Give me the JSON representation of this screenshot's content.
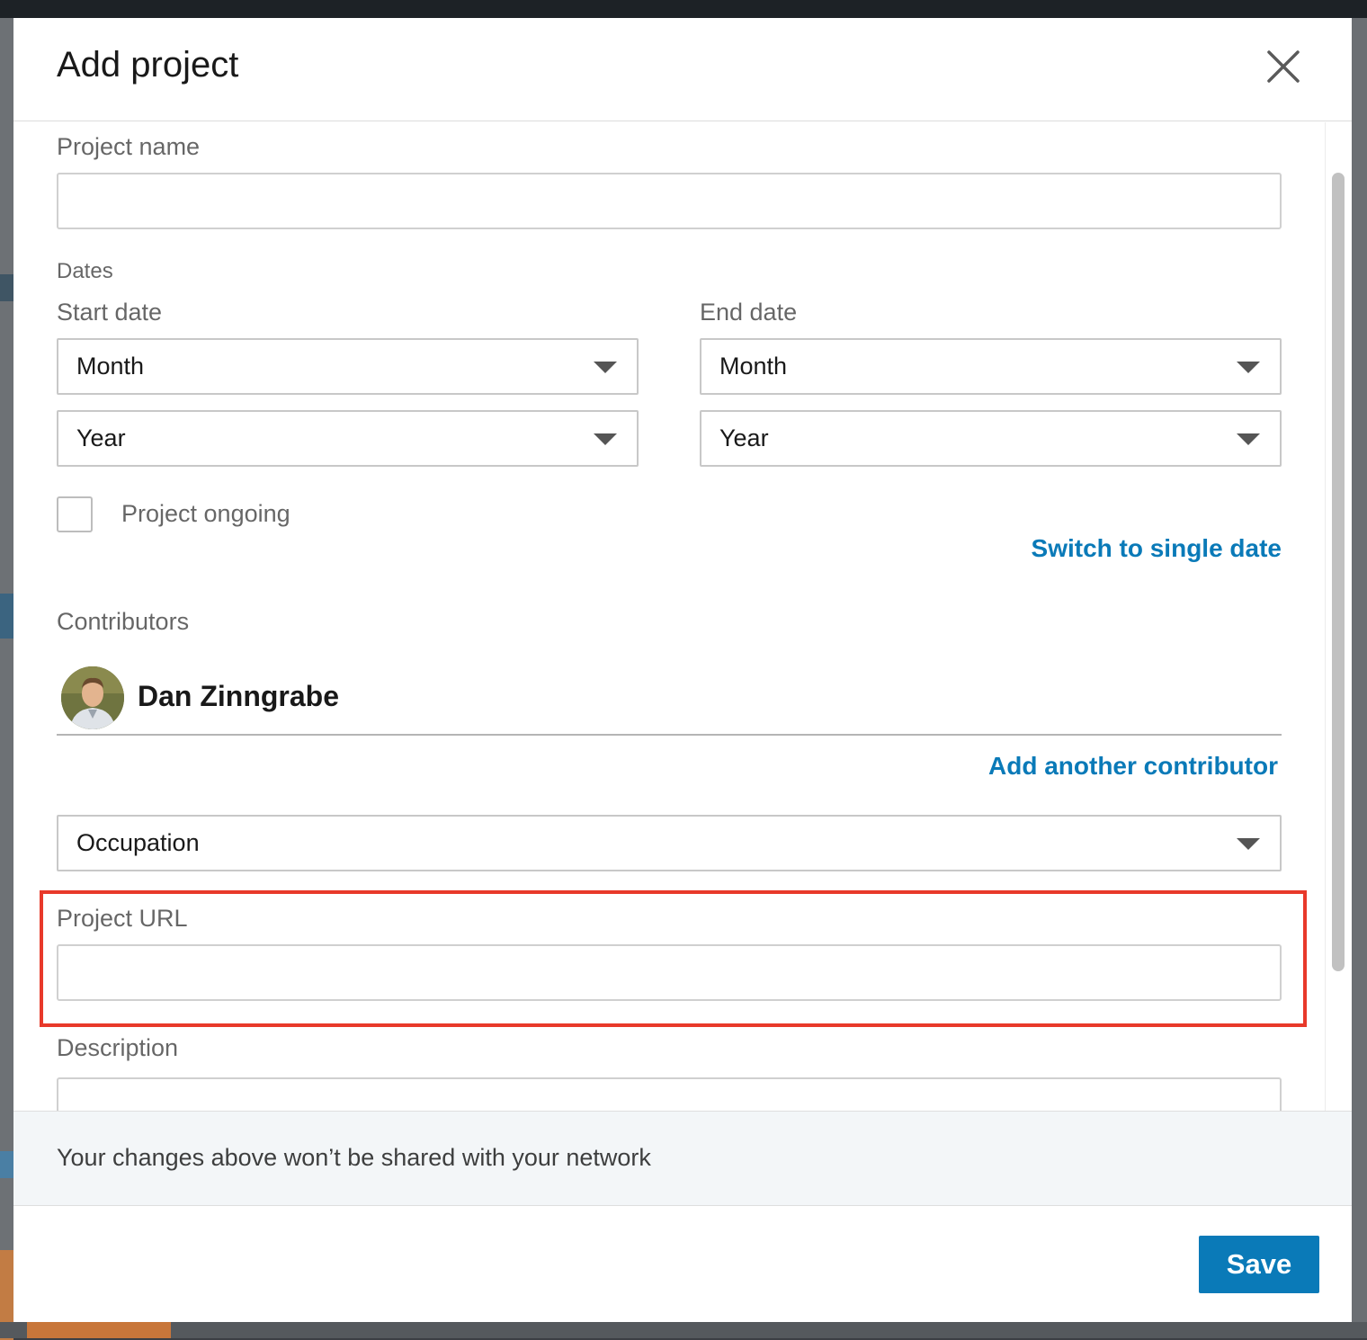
{
  "modal": {
    "title": "Add project",
    "close_icon": "close-icon"
  },
  "form": {
    "project_name": {
      "label": "Project name",
      "value": ""
    },
    "dates": {
      "section_label": "Dates",
      "start": {
        "label": "Start date",
        "month": "Month",
        "year": "Year"
      },
      "end": {
        "label": "End date",
        "month": "Month",
        "year": "Year"
      }
    },
    "ongoing": {
      "label": "Project ongoing",
      "checked": false
    },
    "switch_link": "Switch to single date",
    "contributors": {
      "label": "Contributors",
      "items": [
        {
          "name": "Dan Zinngrabe"
        }
      ],
      "add_link": "Add another contributor"
    },
    "occupation": {
      "value": "Occupation"
    },
    "project_url": {
      "label": "Project URL",
      "value": ""
    },
    "description": {
      "label": "Description",
      "value": ""
    }
  },
  "notice": "Your changes above won’t be shared with your network",
  "footer": {
    "save_label": "Save"
  },
  "colors": {
    "accent": "#0a7ab8",
    "highlight": "#e8392a"
  }
}
